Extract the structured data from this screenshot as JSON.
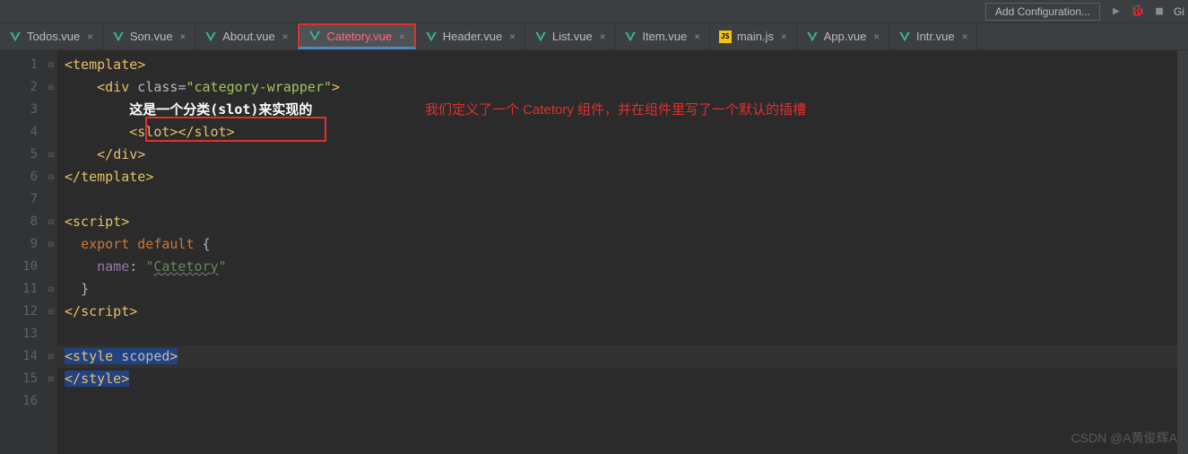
{
  "toolbar": {
    "add_config": "Add Configuration...",
    "gi": "Gi"
  },
  "tabs": [
    {
      "label": "Todos.vue",
      "type": "vue",
      "active": false
    },
    {
      "label": "Son.vue",
      "type": "vue",
      "active": false
    },
    {
      "label": "About.vue",
      "type": "vue",
      "active": false
    },
    {
      "label": "Catetory.vue",
      "type": "vue",
      "active": true
    },
    {
      "label": "Header.vue",
      "type": "vue",
      "active": false
    },
    {
      "label": "List.vue",
      "type": "vue",
      "active": false
    },
    {
      "label": "Item.vue",
      "type": "vue",
      "active": false
    },
    {
      "label": "main.js",
      "type": "js",
      "active": false
    },
    {
      "label": "App.vue",
      "type": "vue",
      "active": false
    },
    {
      "label": "Intr.vue",
      "type": "vue",
      "active": false
    }
  ],
  "gutter_lines": [
    "1",
    "2",
    "3",
    "4",
    "5",
    "6",
    "7",
    "8",
    "9",
    "10",
    "11",
    "12",
    "13",
    "14",
    "15",
    "16"
  ],
  "folds": {
    "1": true,
    "2": true,
    "5": true,
    "6": true,
    "8": true,
    "9": true,
    "11": true,
    "12": true,
    "14": true,
    "15": true
  },
  "code": {
    "l1": {
      "open": "<",
      "tag": "template",
      "close": ">"
    },
    "l2": {
      "open": "<",
      "tag": "div",
      "sp": " ",
      "attr": "class",
      "eq": "=",
      "q1": "\"",
      "val": "category-wrapper",
      "q2": "\"",
      "close": ">"
    },
    "l3": {
      "text": "这是一个分类(slot)来实现的"
    },
    "l4": {
      "o1": "<",
      "t1": "slot",
      "c1": ">",
      "o2": "</",
      "t2": "slot",
      "c2": ">"
    },
    "l5": {
      "open": "</",
      "tag": "div",
      "close": ">"
    },
    "l6": {
      "open": "</",
      "tag": "template",
      "close": ">"
    },
    "l8": {
      "open": "<",
      "tag": "script",
      "close": ">"
    },
    "l9": {
      "kw1": "export ",
      "kw2": "default ",
      "br": "{"
    },
    "l10": {
      "prop": "name",
      "colon": ": ",
      "q1": "\"",
      "val": "Catetory",
      "q2": "\""
    },
    "l11": {
      "br": "}"
    },
    "l12": {
      "open": "</",
      "tag": "script",
      "close": ">"
    },
    "l14": {
      "o": "<",
      "tag": "style",
      "sp": " ",
      "attr": "scoped",
      "c": ">"
    },
    "l15": {
      "o": "</",
      "tag": "style",
      "c": ">"
    }
  },
  "annotation": "我们定义了一个 Catetory 组件，并在组件里写了一个默认的插槽",
  "watermark": "CSDN @A黄俊辉A"
}
